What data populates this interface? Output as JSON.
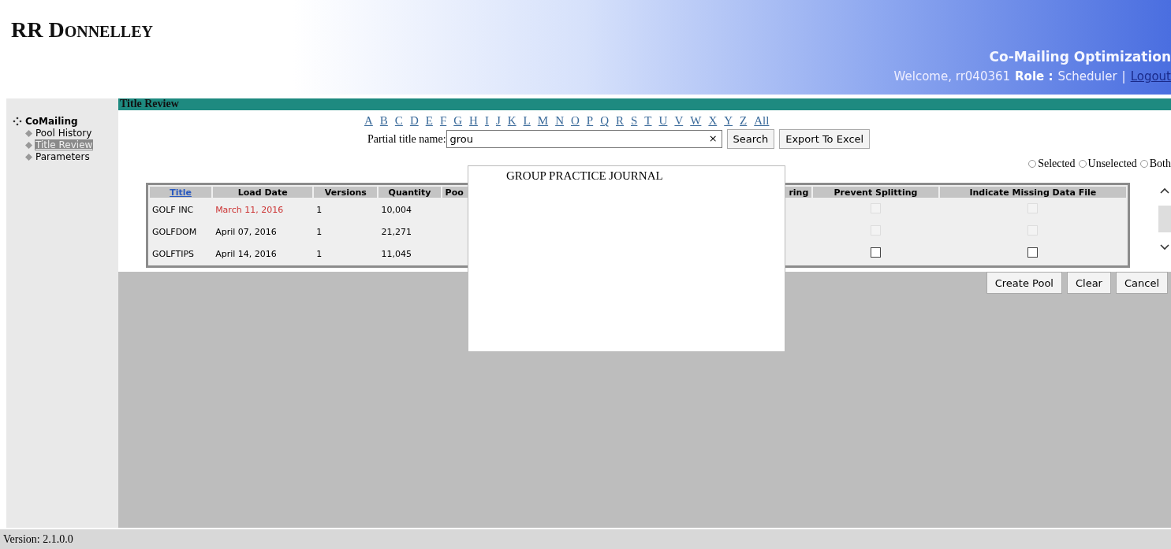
{
  "header": {
    "logo": "RR Donnelley",
    "app_title": "Co-Mailing Optimization",
    "welcome": "Welcome, rr040361",
    "role_label": "Role :",
    "role": "Scheduler",
    "separator": "|",
    "logout": "Logout"
  },
  "sidebar": {
    "group": "CoMailing",
    "items": [
      {
        "label": "Pool History",
        "selected": false
      },
      {
        "label": "Title Review",
        "selected": true
      },
      {
        "label": "Parameters",
        "selected": false
      }
    ]
  },
  "section_title": "Title Review",
  "letters": [
    "A",
    "B",
    "C",
    "D",
    "E",
    "F",
    "G",
    "H",
    "I",
    "J",
    "K",
    "L",
    "M",
    "N",
    "O",
    "P",
    "Q",
    "R",
    "S",
    "T",
    "U",
    "V",
    "W",
    "X",
    "Y",
    "Z",
    "All"
  ],
  "search": {
    "label": "Partial title name:",
    "value": "grou",
    "clear": "×",
    "button": "Search",
    "export": "Export To Excel"
  },
  "suggestions": [
    "GROUP PRACTICE JOURNAL"
  ],
  "filter": [
    {
      "label": "Selected",
      "selected": false
    },
    {
      "label": "Unselected",
      "selected": false
    },
    {
      "label": "Both",
      "selected": false
    }
  ],
  "table": {
    "columns": [
      "Title",
      "Load Date",
      "Versions",
      "Quantity",
      "Poo",
      "ring",
      "Prevent Splitting",
      "Indicate Missing Data File"
    ],
    "rows": [
      {
        "title": "GOLF INC",
        "load_date": "March 11, 2016",
        "date_flagged": true,
        "versions": "1",
        "quantity": "10,004",
        "prevent_splitting": {
          "checked": false,
          "disabled": true
        },
        "missing_data_file": {
          "checked": false,
          "disabled": true
        }
      },
      {
        "title": "GOLFDOM",
        "load_date": "April 07, 2016",
        "date_flagged": false,
        "versions": "1",
        "quantity": "21,271",
        "prevent_splitting": {
          "checked": false,
          "disabled": true
        },
        "missing_data_file": {
          "checked": false,
          "disabled": true
        }
      },
      {
        "title": "GOLFTIPS",
        "load_date": "April 14, 2016",
        "date_flagged": false,
        "versions": "1",
        "quantity": "11,045",
        "prevent_splitting": {
          "checked": false,
          "disabled": false
        },
        "missing_data_file": {
          "checked": false,
          "disabled": false
        }
      }
    ]
  },
  "actions": [
    "Create Pool",
    "Clear",
    "Cancel"
  ],
  "footer": {
    "version": "Version: 2.1.0.0"
  }
}
